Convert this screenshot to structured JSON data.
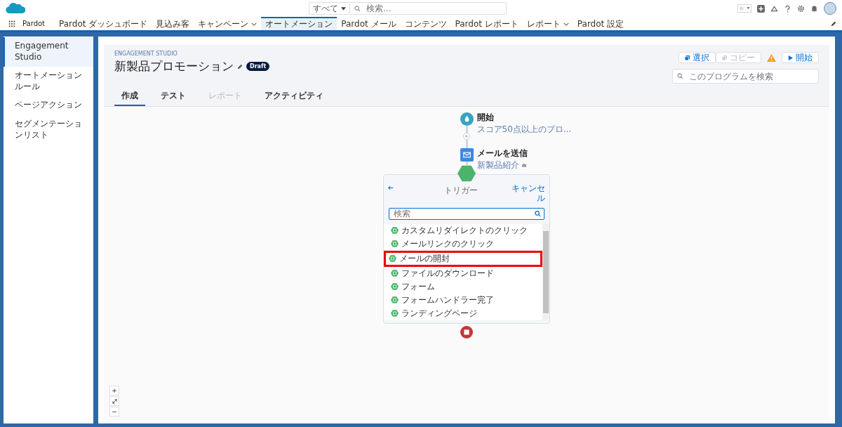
{
  "header": {
    "app_name": "Pardot",
    "scope": "すべて",
    "search_placeholder": "検索..."
  },
  "nav_tabs": [
    {
      "label": "Pardot ダッシュボード",
      "selected": false,
      "dropdown": false
    },
    {
      "label": "見込み客",
      "selected": false,
      "dropdown": false
    },
    {
      "label": "キャンペーン",
      "selected": false,
      "dropdown": true
    },
    {
      "label": "オートメーション",
      "selected": true,
      "dropdown": false
    },
    {
      "label": "Pardot メール",
      "selected": false,
      "dropdown": false
    },
    {
      "label": "コンテンツ",
      "selected": false,
      "dropdown": false
    },
    {
      "label": "Pardot レポート",
      "selected": false,
      "dropdown": false
    },
    {
      "label": "レポート",
      "selected": false,
      "dropdown": true
    },
    {
      "label": "Pardot 設定",
      "selected": false,
      "dropdown": false
    }
  ],
  "sidebar": {
    "items": [
      {
        "label": "Engagement Studio",
        "selected": true
      },
      {
        "label": "オートメーションルール",
        "selected": false
      },
      {
        "label": "ページアクション",
        "selected": false
      },
      {
        "label": "セグメンテーションリスト",
        "selected": false
      }
    ]
  },
  "program": {
    "eyebrow": "ENGAGEMENT STUDIO",
    "title": "新製品プロモーション",
    "status": "Draft",
    "actions": [
      {
        "label": "選択",
        "disabled": false,
        "kind": "select"
      },
      {
        "label": "コピー",
        "disabled": true,
        "kind": "copy"
      },
      {
        "kind": "warning"
      },
      {
        "label": "開始",
        "disabled": false,
        "kind": "start"
      }
    ],
    "search_placeholder": "このプログラムを検索",
    "tabs": [
      {
        "label": "作成",
        "selected": true,
        "disabled": false
      },
      {
        "label": "テスト",
        "selected": false,
        "disabled": false
      },
      {
        "label": "レポート",
        "selected": false,
        "disabled": true
      },
      {
        "label": "アクティビティ",
        "selected": false,
        "disabled": false
      }
    ]
  },
  "flow": {
    "start": {
      "title": "開始",
      "subtitle": "スコア50点以上のプロ..."
    },
    "email": {
      "title": "メールを送信",
      "subtitle": "新製品紹介"
    },
    "trigger_panel": {
      "title": "トリガー",
      "cancel": "キャンセル",
      "search_placeholder": "検索",
      "items": [
        {
          "label": "カスタムリダイレクトのクリック",
          "highlighted": false
        },
        {
          "label": "メールリンクのクリック",
          "highlighted": false
        },
        {
          "label": "メールの開封",
          "highlighted": true
        },
        {
          "label": "ファイルのダウンロード",
          "highlighted": false
        },
        {
          "label": "フォーム",
          "highlighted": false
        },
        {
          "label": "フォームハンドラー完了",
          "highlighted": false
        },
        {
          "label": "ランディングページ",
          "highlighted": false
        }
      ]
    }
  },
  "zoom_controls": [
    "+",
    "−"
  ]
}
